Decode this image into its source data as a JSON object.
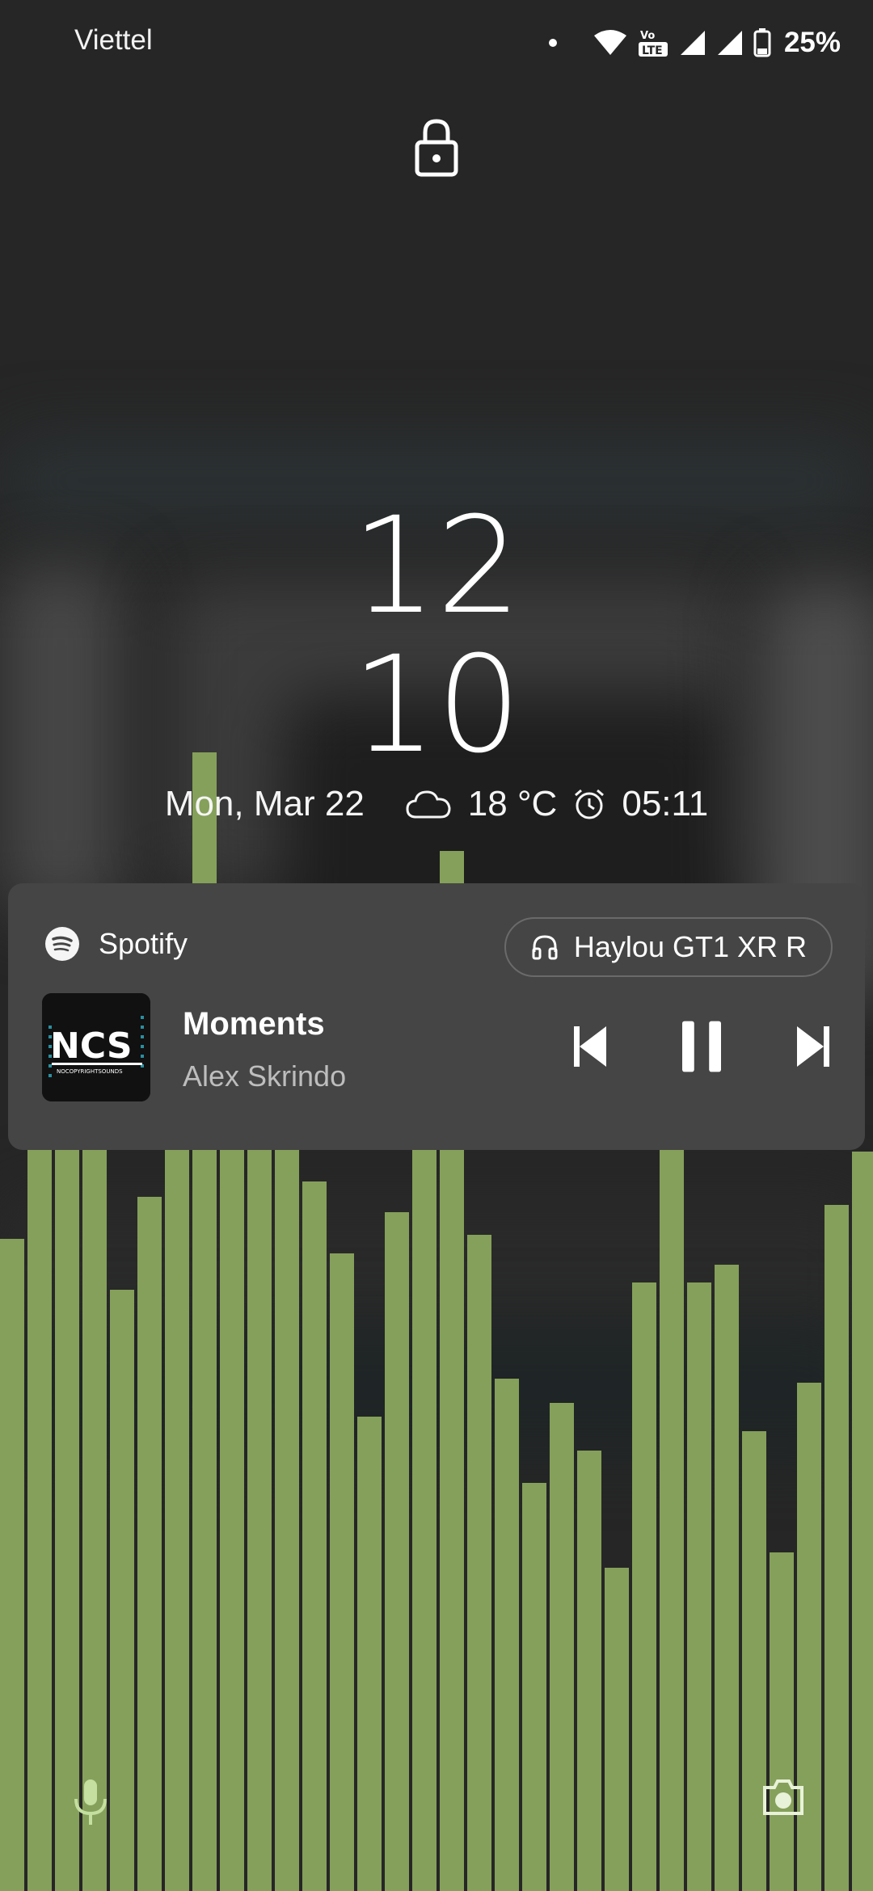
{
  "status_bar": {
    "carrier": "Viettel",
    "battery_percent": "25%",
    "icons": [
      "notification-dot-icon",
      "wifi-icon",
      "volte-lte-icon",
      "signal-icon",
      "signal-icon",
      "battery-icon"
    ]
  },
  "lockscreen": {
    "lock_icon": "lock-icon",
    "clock_hour": "12",
    "clock_minute": "10",
    "date": "Mon, Mar 22",
    "weather_icon": "cloud-icon",
    "temperature": "18 °C",
    "alarm_icon": "alarm-icon",
    "alarm_time": "05:11"
  },
  "media": {
    "app_name": "Spotify",
    "output_device": "Haylou GT1 XR R",
    "track_title": "Moments",
    "artist": "Alex Skrindo",
    "album_art_text": "NCS",
    "album_art_subtext": "NOCOPYRIGHTSOUNDS",
    "controls": [
      "previous-icon",
      "pause-icon",
      "next-icon"
    ]
  },
  "visualizer": {
    "color": "#85a05a",
    "levels": [
      0.345,
      0.5,
      0.465,
      0.395,
      0.318,
      0.367,
      0.531,
      0.602,
      0.492,
      0.401,
      0.392,
      0.375,
      0.337,
      0.251,
      0.359,
      0.479,
      0.55,
      0.347,
      0.271,
      0.216,
      0.258,
      0.233,
      0.171,
      0.322,
      0.466,
      0.322,
      0.331,
      0.243,
      0.179,
      0.269,
      0.363,
      0.391
    ]
  },
  "shortcuts": {
    "left": "microphone-icon",
    "right": "camera-icon"
  },
  "colors": {
    "background": "#262626",
    "card": "#454545",
    "accent_bar": "#85a05a"
  }
}
